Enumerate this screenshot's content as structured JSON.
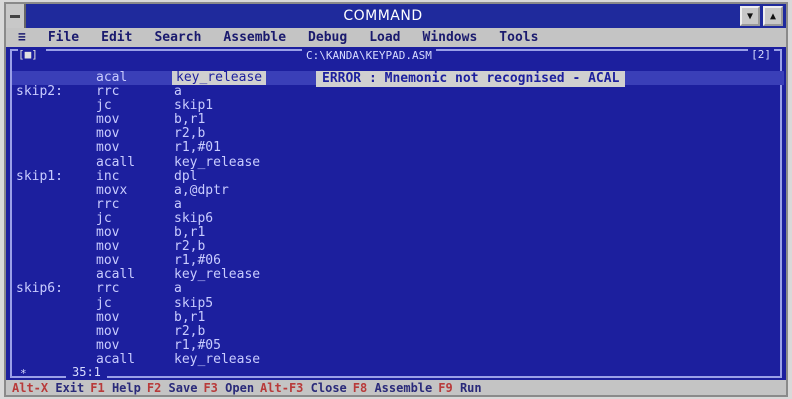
{
  "window": {
    "title": "COMMAND"
  },
  "menu": [
    "File",
    "Edit",
    "Search",
    "Assemble",
    "Debug",
    "Load",
    "Windows",
    "Tools"
  ],
  "editor": {
    "close_box": "[■]",
    "filename": "C:\\KANDA\\KEYPAD.ASM",
    "window_number": "[2]",
    "error_message": "ERROR : Mnemonic not recognised - ACAL",
    "lines": [
      {
        "label": "",
        "op": "acal",
        "arg": "key_release",
        "current": true
      },
      {
        "label": "skip2:",
        "op": "rrc",
        "arg": "a"
      },
      {
        "label": "",
        "op": "jc",
        "arg": "skip1"
      },
      {
        "label": "",
        "op": "mov",
        "arg": "b,r1"
      },
      {
        "label": "",
        "op": "mov",
        "arg": "r2,b"
      },
      {
        "label": "",
        "op": "mov",
        "arg": "r1,#01"
      },
      {
        "label": "",
        "op": "acall",
        "arg": "key_release"
      },
      {
        "label": "skip1:",
        "op": "inc",
        "arg": "dpl"
      },
      {
        "label": "",
        "op": "movx",
        "arg": "a,@dptr"
      },
      {
        "label": "",
        "op": "rrc",
        "arg": "a"
      },
      {
        "label": "",
        "op": "jc",
        "arg": "skip6"
      },
      {
        "label": "",
        "op": "mov",
        "arg": "b,r1"
      },
      {
        "label": "",
        "op": "mov",
        "arg": "r2,b"
      },
      {
        "label": "",
        "op": "mov",
        "arg": "r1,#06"
      },
      {
        "label": "",
        "op": "acall",
        "arg": "key_release"
      },
      {
        "label": "skip6:",
        "op": "rrc",
        "arg": "a"
      },
      {
        "label": "",
        "op": "jc",
        "arg": "skip5"
      },
      {
        "label": "",
        "op": "mov",
        "arg": "b,r1"
      },
      {
        "label": "",
        "op": "mov",
        "arg": "r2,b"
      },
      {
        "label": "",
        "op": "mov",
        "arg": "r1,#05"
      },
      {
        "label": "",
        "op": "acall",
        "arg": "key_release"
      }
    ],
    "status_icon": "*",
    "cursor_position": "35:1"
  },
  "function_keys": [
    {
      "key": "Alt-X",
      "label": "Exit"
    },
    {
      "key": "F1",
      "label": "Help"
    },
    {
      "key": "F2",
      "label": "Save"
    },
    {
      "key": "F3",
      "label": "Open"
    },
    {
      "key": "Alt-F3",
      "label": "Close"
    },
    {
      "key": "F8",
      "label": "Assemble"
    },
    {
      "key": "F9",
      "label": "Run"
    }
  ]
}
